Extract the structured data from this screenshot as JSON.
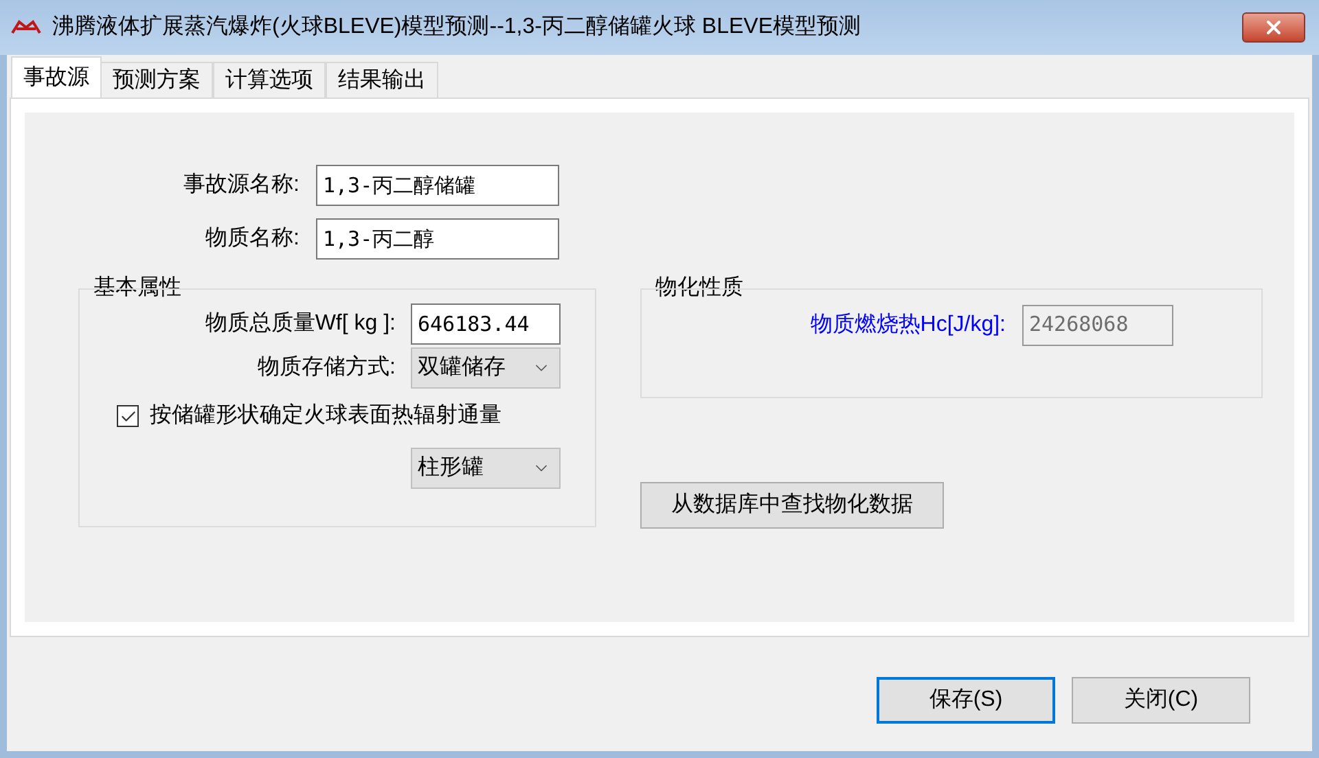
{
  "window": {
    "title": "沸腾液体扩展蒸汽爆炸(火球BLEVE)模型预测--1,3-丙二醇储罐火球 BLEVE模型预测"
  },
  "tabs": [
    {
      "label": "事故源",
      "selected": true
    },
    {
      "label": "预测方案",
      "selected": false
    },
    {
      "label": "计算选项",
      "selected": false
    },
    {
      "label": "结果输出",
      "selected": false
    }
  ],
  "source_name": {
    "label": "事故源名称:",
    "value": "1,3-丙二醇储罐"
  },
  "substance_name": {
    "label": "物质名称:",
    "value": "1,3-丙二醇"
  },
  "basic_properties": {
    "title": "基本属性",
    "mass": {
      "label": "物质总质量Wf[ kg ]:",
      "value": "646183.44"
    },
    "storage": {
      "label": "物质存储方式:",
      "value": "双罐储存"
    },
    "by_shape": {
      "label": "按储罐形状确定火球表面热辐射通量",
      "checked": true
    },
    "shape": {
      "value": "柱形罐"
    }
  },
  "physchem_properties": {
    "title": "物化性质",
    "heat": {
      "label": "物质燃烧热Hc[J/kg]:",
      "value": "24268068",
      "disabled": true
    }
  },
  "lookup_button": "从数据库中查找物化数据",
  "buttons": [
    {
      "label": "保存(S)",
      "default": true
    },
    {
      "label": "关闭(C)",
      "default": false
    }
  ]
}
